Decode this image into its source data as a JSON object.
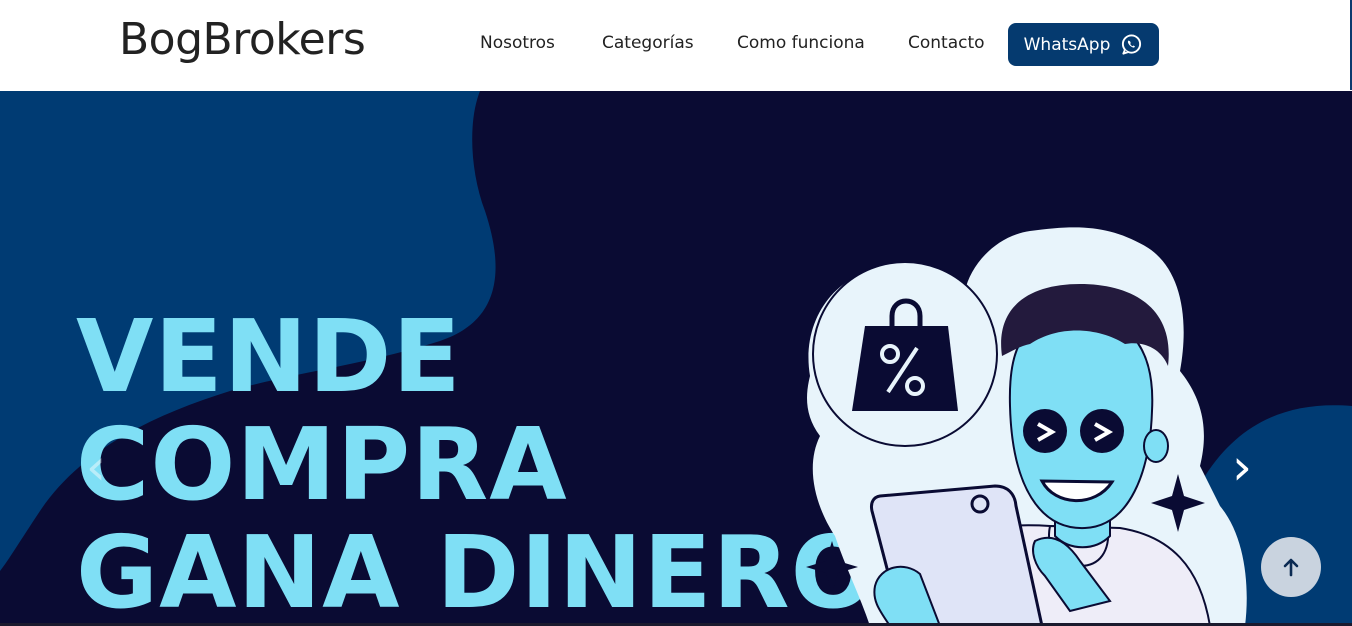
{
  "brand": {
    "name": "BogBrokers"
  },
  "nav": {
    "items": [
      {
        "label": "Nosotros"
      },
      {
        "label": "Categorías"
      },
      {
        "label": "Como funciona"
      },
      {
        "label": "Contacto"
      }
    ],
    "whatsapp_label": "WhatsApp"
  },
  "hero": {
    "lines": [
      "VENDE",
      "COMPRA",
      "GANA DINERO"
    ],
    "prev_arrow": "‹",
    "next_arrow": "›",
    "illustration_icons": [
      "shopping-bag-percent-icon",
      "sparkle-icon",
      "phone-icon"
    ]
  },
  "colors": {
    "header_bg": "#ffffff",
    "accent": "#053a6f",
    "hero_bg": "#0a0b33",
    "hero_blob": "#003b73",
    "headline": "#7fdff5",
    "scroll_button": "#c9d3df"
  },
  "icons": {
    "whatsapp": "whatsapp-icon",
    "scroll_top": "arrow-up-icon"
  }
}
